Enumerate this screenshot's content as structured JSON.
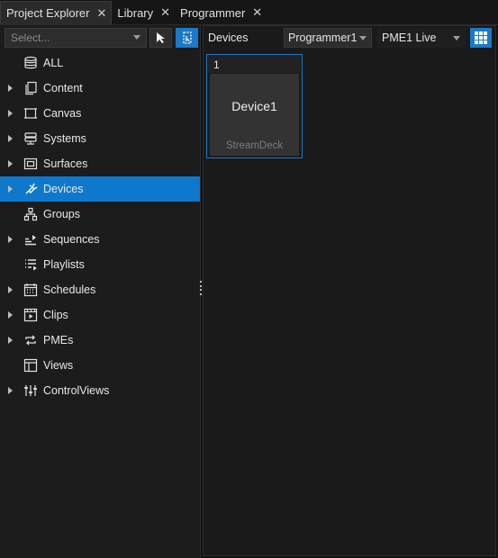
{
  "tabs": [
    {
      "label": "Project Explorer",
      "active": true
    },
    {
      "label": "Library",
      "active": false
    },
    {
      "label": "Programmer",
      "active": false
    }
  ],
  "explorer": {
    "search_placeholder": "Select...",
    "tree": [
      {
        "label": "ALL",
        "icon": "database-icon",
        "expandable": false,
        "selected": false
      },
      {
        "label": "Content",
        "icon": "content-icon",
        "expandable": true,
        "selected": false
      },
      {
        "label": "Canvas",
        "icon": "canvas-icon",
        "expandable": true,
        "selected": false
      },
      {
        "label": "Systems",
        "icon": "systems-icon",
        "expandable": true,
        "selected": false
      },
      {
        "label": "Surfaces",
        "icon": "surfaces-icon",
        "expandable": true,
        "selected": false
      },
      {
        "label": "Devices",
        "icon": "devices-icon",
        "expandable": true,
        "selected": true
      },
      {
        "label": "Groups",
        "icon": "groups-icon",
        "expandable": false,
        "selected": false
      },
      {
        "label": "Sequences",
        "icon": "sequences-icon",
        "expandable": true,
        "selected": false
      },
      {
        "label": "Playlists",
        "icon": "playlists-icon",
        "expandable": false,
        "selected": false
      },
      {
        "label": "Schedules",
        "icon": "calendar-icon",
        "expandable": true,
        "selected": false
      },
      {
        "label": "Clips",
        "icon": "clips-icon",
        "expandable": true,
        "selected": false
      },
      {
        "label": "PMEs",
        "icon": "pme-icon",
        "expandable": true,
        "selected": false
      },
      {
        "label": "Views",
        "icon": "views-icon",
        "expandable": false,
        "selected": false
      },
      {
        "label": "ControlViews",
        "icon": "sliders-icon",
        "expandable": true,
        "selected": false
      }
    ]
  },
  "devices_panel": {
    "label": "Devices",
    "programmer_select": "Programmer1",
    "pme_select": "PME1 Live",
    "tiles": [
      {
        "number": "1",
        "name": "Device1",
        "type": "StreamDeck"
      }
    ]
  },
  "colors": {
    "accent": "#0E78CC",
    "background": "#1C1C1C"
  }
}
